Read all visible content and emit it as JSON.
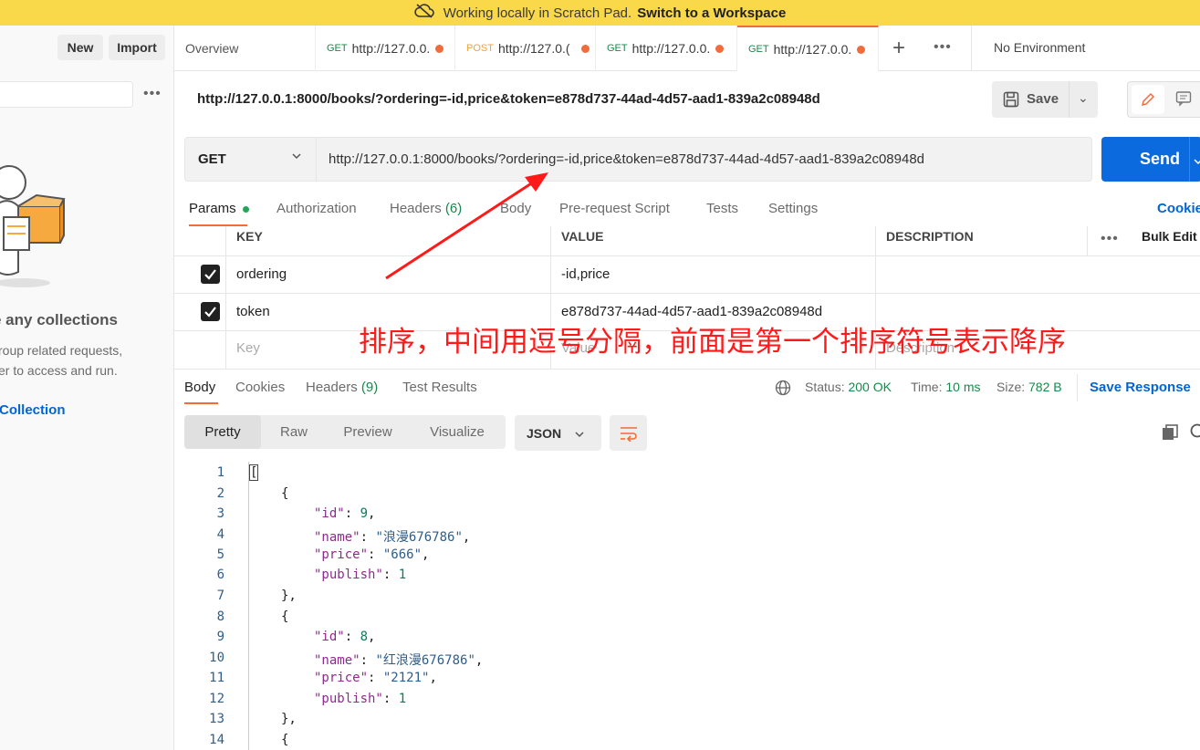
{
  "banner": {
    "text": "Working locally in Scratch Pad.",
    "link": "Switch to a Workspace",
    "icon": "cloud-off-icon"
  },
  "sidebar": {
    "new_label": "New",
    "import_label": "Import",
    "empty_title": "e any collections",
    "empty_desc_1": "roup related requests,",
    "empty_desc_2": "er to access and run.",
    "create_link": "Collection"
  },
  "tabs": {
    "overview": "Overview",
    "items": [
      {
        "method": "GET",
        "url": "http://127.0.0.",
        "method_color": "#168a4a"
      },
      {
        "method": "POST",
        "url": "http://127.0.(",
        "method_color": "#f0a23a"
      },
      {
        "method": "GET",
        "url": "http://127.0.0.",
        "method_color": "#168a4a"
      },
      {
        "method": "GET",
        "url": "http://127.0.0.",
        "method_color": "#168a4a"
      }
    ],
    "environment": "No Environment"
  },
  "request": {
    "title": "http://127.0.0.1:8000/books/?ordering=-id,price&token=e878d737-44ad-4d57-aad1-839a2c08948d",
    "save_label": "Save",
    "method": "GET",
    "url": "http://127.0.0.1:8000/books/?ordering=-id,price&token=e878d737-44ad-4d57-aad1-839a2c08948d",
    "send_label": "Send",
    "subtabs": {
      "params": "Params",
      "authorization": "Authorization",
      "headers": "Headers",
      "headers_count": "(6)",
      "body": "Body",
      "prerequest": "Pre-request Script",
      "tests": "Tests",
      "settings": "Settings",
      "cookies": "Cookie"
    }
  },
  "params": {
    "headers": {
      "key": "KEY",
      "value": "VALUE",
      "description": "DESCRIPTION",
      "bulk_edit": "Bulk Edit"
    },
    "rows": [
      {
        "key": "ordering",
        "value": "-id,price",
        "checked": true
      },
      {
        "key": "token",
        "value": "e878d737-44ad-4d57-aad1-839a2c08948d",
        "checked": true
      }
    ],
    "placeholder": {
      "key": "Key",
      "value": "Value",
      "description": "Description"
    }
  },
  "annotation": "排序，中间用逗号分隔，前面是第一个排序符号表示降序",
  "response": {
    "tabs": {
      "body": "Body",
      "cookies": "Cookies",
      "headers": "Headers",
      "headers_count": "(9)",
      "test_results": "Test Results"
    },
    "status_label": "Status:",
    "status_value": "200 OK",
    "time_label": "Time:",
    "time_value": "10 ms",
    "size_label": "Size:",
    "size_value": "782 B",
    "save_response": "Save Response",
    "views": {
      "pretty": "Pretty",
      "raw": "Raw",
      "preview": "Preview",
      "visualize": "Visualize"
    },
    "format": "JSON"
  },
  "code_lines": [
    "1",
    "2",
    "3",
    "4",
    "5",
    "6",
    "7",
    "8",
    "9",
    "10",
    "11",
    "12",
    "13",
    "14"
  ],
  "json_body": {
    "item1": {
      "id": "9",
      "name": "\"浪漫676786\"",
      "price": "\"666\"",
      "publish": "1"
    },
    "item2": {
      "id": "8",
      "name": "\"红浪漫676786\"",
      "price": "\"2121\"",
      "publish": "1"
    }
  }
}
